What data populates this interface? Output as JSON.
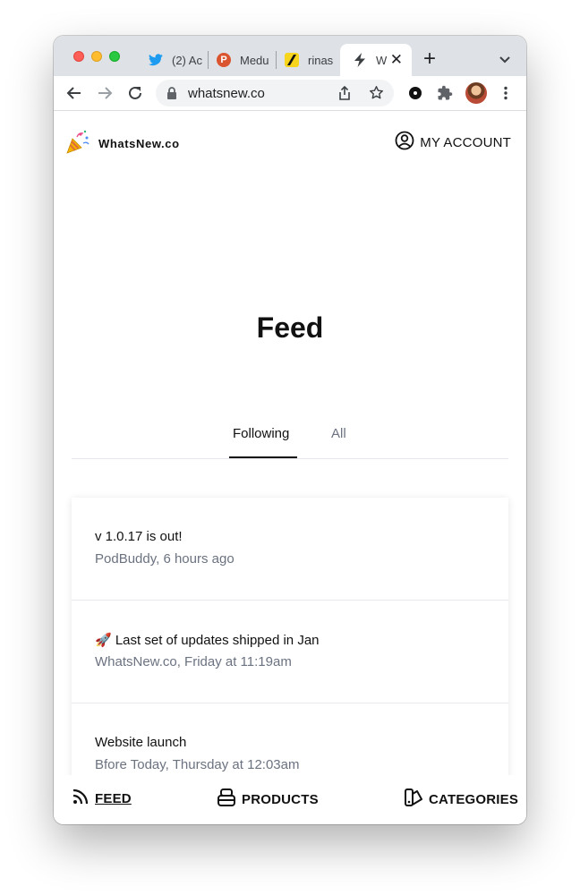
{
  "browser": {
    "tabs": [
      {
        "label": "(2) Ac",
        "icon": "twitter-icon",
        "color": "#1d9bf0"
      },
      {
        "label": "Medu",
        "icon": "producthunt-icon",
        "color": "#da552f"
      },
      {
        "label": "rinas",
        "icon": "slash-app-icon",
        "color": "#f7d51d"
      },
      {
        "label": "W",
        "icon": "lightning-icon",
        "active": true
      }
    ],
    "url": "whatsnew.co"
  },
  "header": {
    "logo_text": "WhatsNew.co",
    "account_label": "MY ACCOUNT"
  },
  "page_title": "Feed",
  "feed_tabs": {
    "following": "Following",
    "all": "All",
    "selected": "Following"
  },
  "feed_items": [
    {
      "title": "v 1.0.17 is out!",
      "meta": "PodBuddy, 6 hours ago"
    },
    {
      "title": "🚀 Last set of updates shipped in Jan",
      "meta": "WhatsNew.co, Friday at 11:19am"
    },
    {
      "title": "Website launch",
      "meta": "Bfore Today, Thursday at 12:03am"
    }
  ],
  "bottom_nav": {
    "feed": "FEED",
    "products": "PRODUCTS",
    "categories": "CATEGORIES",
    "active": "FEED"
  }
}
